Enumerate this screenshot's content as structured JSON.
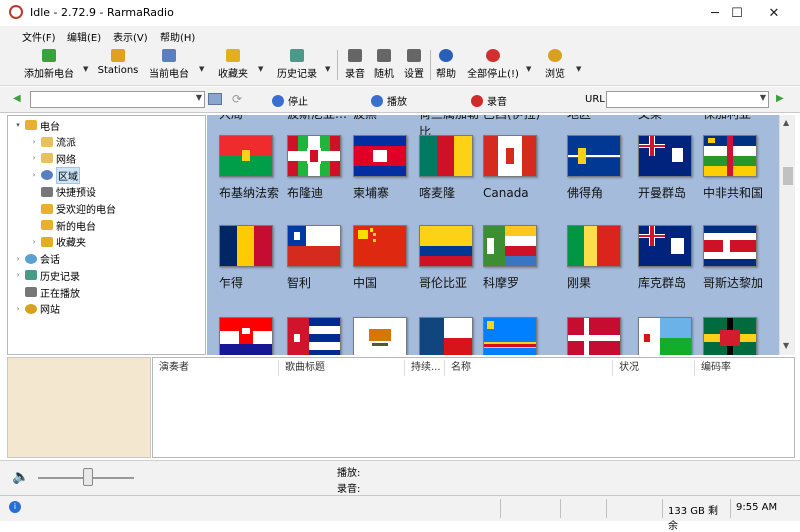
{
  "window": {
    "title": "Idle - 2.72.9 - RarmaRadio",
    "minimize": "─",
    "maximize": "☐",
    "close": "✕"
  },
  "menu": [
    "文件(F)",
    "编辑(E)",
    "表示(V)",
    "帮助(H)"
  ],
  "toolbar": [
    {
      "label": "添加新电台",
      "icon": "plus-icon",
      "color": "#3aa23a"
    },
    {
      "label": "Stations",
      "icon": "folder-icon",
      "color": "#e0a020"
    },
    {
      "label": "当前电台",
      "icon": "list-icon",
      "color": "#5a7fc0"
    },
    {
      "label": "收藏夹",
      "icon": "star-icon",
      "color": "#e0b020"
    },
    {
      "label": "历史记录",
      "icon": "history-icon",
      "color": "#4a9a8a"
    },
    {
      "label": "录音",
      "icon": "record-icon",
      "color": "#666666"
    },
    {
      "label": "随机",
      "icon": "dice-icon",
      "color": "#666666"
    },
    {
      "label": "设置",
      "icon": "wrench-icon",
      "color": "#666666"
    },
    {
      "label": "帮助",
      "icon": "help-icon",
      "color": "#2a5fb8"
    },
    {
      "label": "全部停止(!)",
      "icon": "stop-icon",
      "color": "#d03030"
    },
    {
      "label": "浏览",
      "icon": "browser-icon",
      "color": "#d8a020"
    }
  ],
  "player": {
    "stop": "停止",
    "play": "播放",
    "record": "录音",
    "url_label": "URL"
  },
  "tree": [
    {
      "label": "电台",
      "level": 0,
      "exp": "▾"
    },
    {
      "label": "流派",
      "level": 1,
      "exp": "›"
    },
    {
      "label": "网络",
      "level": 1,
      "exp": "›"
    },
    {
      "label": "区域",
      "level": 1,
      "exp": "›",
      "selected": true
    },
    {
      "label": "快捷预设",
      "level": 1,
      "exp": ""
    },
    {
      "label": "受欢迎的电台",
      "level": 1,
      "exp": ""
    },
    {
      "label": "新的电台",
      "level": 1,
      "exp": ""
    },
    {
      "label": "收藏夹",
      "level": 1,
      "exp": "›"
    },
    {
      "label": "会话",
      "level": 0,
      "exp": "›"
    },
    {
      "label": "历史记录",
      "level": 0,
      "exp": "›"
    },
    {
      "label": "正在播放",
      "level": 0,
      "exp": ""
    },
    {
      "label": "网站",
      "level": 0,
      "exp": "›"
    }
  ],
  "regions_top_partial": [
    "大局",
    "波斯尼亚…",
    "波黑",
    "荷兰属加勒比",
    "巴西(伊拉)",
    "地区",
    "文莱",
    "保加利亚"
  ],
  "regions": [
    [
      "布基纳法索",
      "布隆迪",
      "柬埔寨",
      "喀麦隆",
      "Canada",
      "佛得角",
      "开曼群岛",
      "中非共和国"
    ],
    [
      "乍得",
      "智利",
      "中国",
      "哥伦比亚",
      "科摩罗",
      "刚果",
      "库克群岛",
      "哥斯达黎加"
    ]
  ],
  "columns": [
    "演奏者",
    "歌曲标题",
    "持续...",
    "名称",
    "状况",
    "编码率"
  ],
  "playback": {
    "playing_label": "播放:",
    "recording_label": "录音:"
  },
  "status": {
    "disk": "133 GB 剩余",
    "time": "9:55 AM"
  }
}
